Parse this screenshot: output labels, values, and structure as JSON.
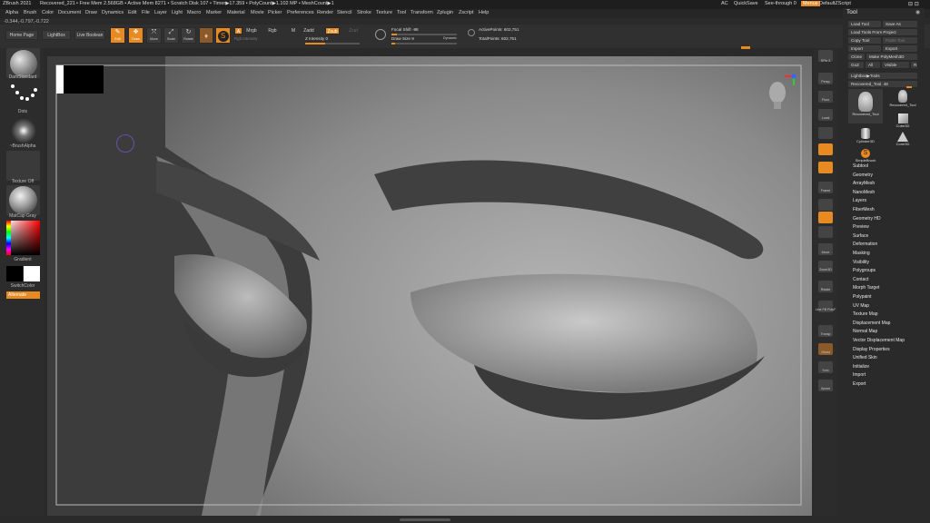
{
  "titlebar": {
    "app": "ZBrush 2021",
    "file": "Recovered_221",
    "stats": "• Free Mem 2.568GB • Active Mem 8271 • Scratch Disk 107 • Timer▶17.359 • PolyCount▶1.102 MP • MeshCount▶1",
    "ac": "AC",
    "quicksave": "QuickSave",
    "seethrough": "See-through 0",
    "menus_btn": "Menus",
    "script": "DefaultZScript"
  },
  "menu": [
    "Alpha",
    "Brush",
    "Color",
    "Document",
    "Draw",
    "Dynamics",
    "Edit",
    "File",
    "Layer",
    "Light",
    "Macro",
    "Marker",
    "Material",
    "Movie",
    "Picker",
    "Preferences",
    "Render",
    "Stencil",
    "Stroke",
    "Texture",
    "Tool",
    "Transform",
    "Zplugin",
    "Zscript",
    "Help"
  ],
  "coords": "-0.344,-0.797,-0.722",
  "toolbar": {
    "home": "Home Page",
    "lightbox": "LightBox",
    "live_boolean": "Live Boolean",
    "edit": "Edit",
    "draw": "Draw",
    "move": "Move",
    "scale": "Scale",
    "rotate": "Rotate",
    "a": "A",
    "mrgb": "Mrgb",
    "rgb": "Rgb",
    "m": "M",
    "zadd": "Zadd",
    "zsub": "Zsub",
    "zcut": "Zcut",
    "rgb_intensity": "Rgb Intensity",
    "z_intensity": "Z Intensity 0",
    "focal_shift": "Focal Shift -88",
    "draw_size": "Draw Size 9",
    "dynamic": "Dynamic",
    "active_points": "ActivePoints: 602,751",
    "total_points": "TotalPoints: 602,751"
  },
  "left_shelf": {
    "brush": "DamStandard",
    "stroke": "Dots",
    "alpha": "~BrushAlpha",
    "texture": "Texture Off",
    "material": "MatCap Gray",
    "gradient": "Gradient",
    "switch_color": "SwitchColor",
    "alternate": "Alternate"
  },
  "right_shelf": [
    "SPix 3",
    "Persp",
    "Floor",
    "Local",
    "Frame",
    "Move",
    "Zoom3D",
    "Rotate",
    "Line Fill PolyF",
    "Transp",
    "Ghost",
    "Solo",
    "Xpose"
  ],
  "tool_panel": {
    "title": "Tool",
    "load_tool": "Load Tool",
    "save_as": "Save As",
    "load_from_project": "Load Tools From Project",
    "copy_tool": "Copy Tool",
    "paste_tool": "Paste Tool",
    "import": "Import",
    "export": "Export",
    "clone": "Clone",
    "make_polymesh": "Make PolyMesh3D",
    "goz": "GoZ",
    "all": "All",
    "visible": "Visible",
    "r": "R",
    "lightbox_tools": "Lightbox▶Tools",
    "current_tool": "Recovered_Tool. 48",
    "thumbs": [
      "Recovered_Tool",
      "Recovered_Tool",
      "Cube3D",
      "Cylinder3D",
      "Cone3D",
      "SimpleBrush"
    ],
    "subpalettes": [
      "Subtool",
      "Geometry",
      "ArrayMesh",
      "NanoMesh",
      "Layers",
      "FiberMesh",
      "Geometry HD",
      "Preview",
      "Surface",
      "Deformation",
      "Masking",
      "Visibility",
      "Polygroups",
      "Contact",
      "Morph Target",
      "Polypaint",
      "UV Map",
      "Texture Map",
      "Displacement Map",
      "Normal Map",
      "Vector Displacement Map",
      "Display Properties",
      "Unified Skin",
      "Initialize",
      "Import",
      "Export"
    ]
  }
}
